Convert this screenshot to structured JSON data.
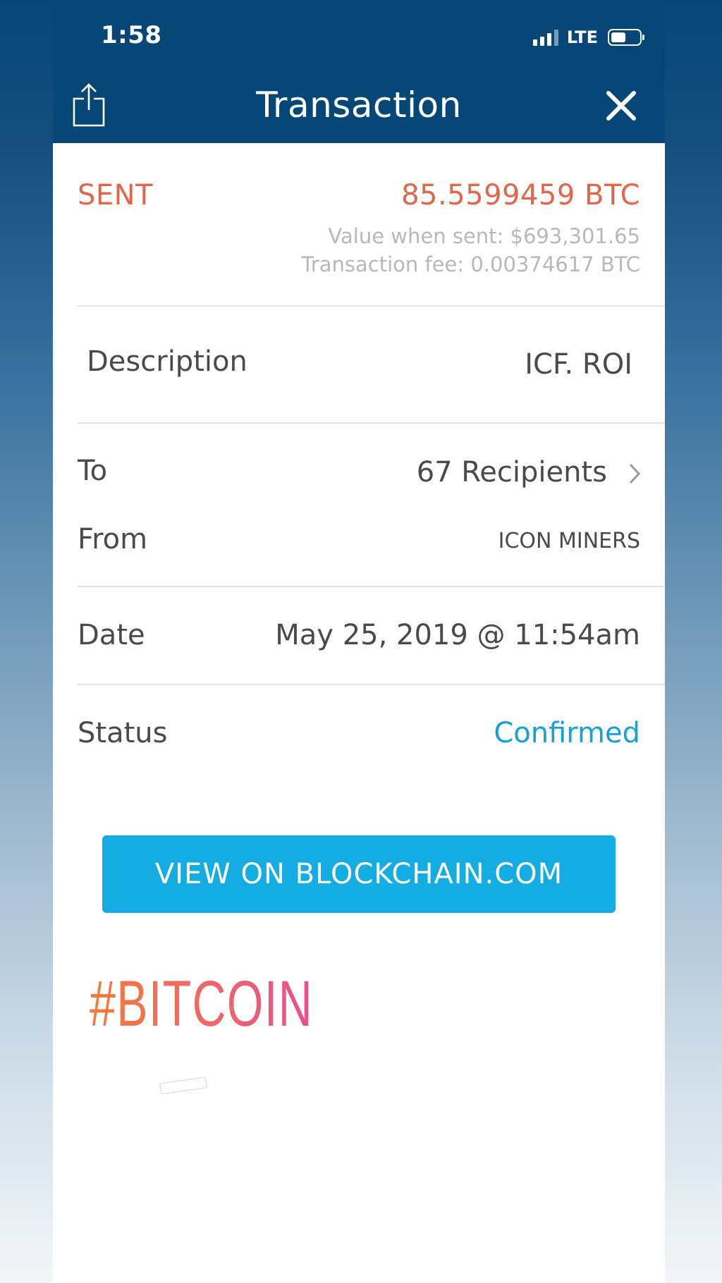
{
  "status_bar": {
    "time": "1:58",
    "network": "LTE",
    "icons": [
      "signal-icon",
      "battery-icon"
    ]
  },
  "nav": {
    "title": "Transaction",
    "left_icon": "share-icon",
    "right_icon": "close-icon"
  },
  "summary": {
    "direction": "SENT",
    "amount": "85.5599459 BTC",
    "value_when_sent": "Value when sent: $693,301.65",
    "fee": "Transaction fee: 0.00374617 BTC"
  },
  "details": {
    "description_label": "Description",
    "description_value": "ICF. ROI",
    "to_label": "To",
    "to_value": "67 Recipients",
    "from_label": "From",
    "from_value": "ICON MINERS",
    "date_label": "Date",
    "date_value": "May 25, 2019 @ 11:54am",
    "status_label": "Status",
    "status_value": "Confirmed"
  },
  "actions": {
    "view_button": "VIEW ON BLOCKCHAIN.COM"
  },
  "overlay": {
    "hashtag": "#BITCOIN"
  },
  "colors": {
    "header": "#064778",
    "sent": "#e2664a",
    "confirmed": "#13a2dc",
    "button": "#13ade4"
  }
}
